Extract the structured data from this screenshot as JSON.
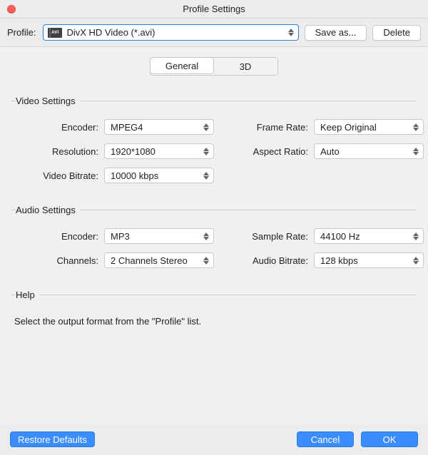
{
  "window": {
    "title": "Profile Settings"
  },
  "toolbar": {
    "profile_label": "Profile:",
    "profile_value": "DivX HD Video (*.avi)",
    "profile_icon_text": "AVI",
    "save_as_label": "Save as...",
    "delete_label": "Delete"
  },
  "tabs": {
    "general": "General",
    "three_d": "3D",
    "active": "General"
  },
  "video": {
    "legend": "Video Settings",
    "encoder_label": "Encoder:",
    "encoder_value": "MPEG4",
    "resolution_label": "Resolution:",
    "resolution_value": "1920*1080",
    "bitrate_label": "Video Bitrate:",
    "bitrate_value": "10000 kbps",
    "framerate_label": "Frame Rate:",
    "framerate_value": "Keep Original",
    "aspect_label": "Aspect Ratio:",
    "aspect_value": "Auto"
  },
  "audio": {
    "legend": "Audio Settings",
    "encoder_label": "Encoder:",
    "encoder_value": "MP3",
    "channels_label": "Channels:",
    "channels_value": "2 Channels Stereo",
    "samplerate_label": "Sample Rate:",
    "samplerate_value": "44100 Hz",
    "bitrate_label": "Audio Bitrate:",
    "bitrate_value": "128 kbps"
  },
  "help": {
    "legend": "Help",
    "text": "Select the output format from the \"Profile\" list."
  },
  "footer": {
    "restore_label": "Restore Defaults",
    "cancel_label": "Cancel",
    "ok_label": "OK"
  }
}
